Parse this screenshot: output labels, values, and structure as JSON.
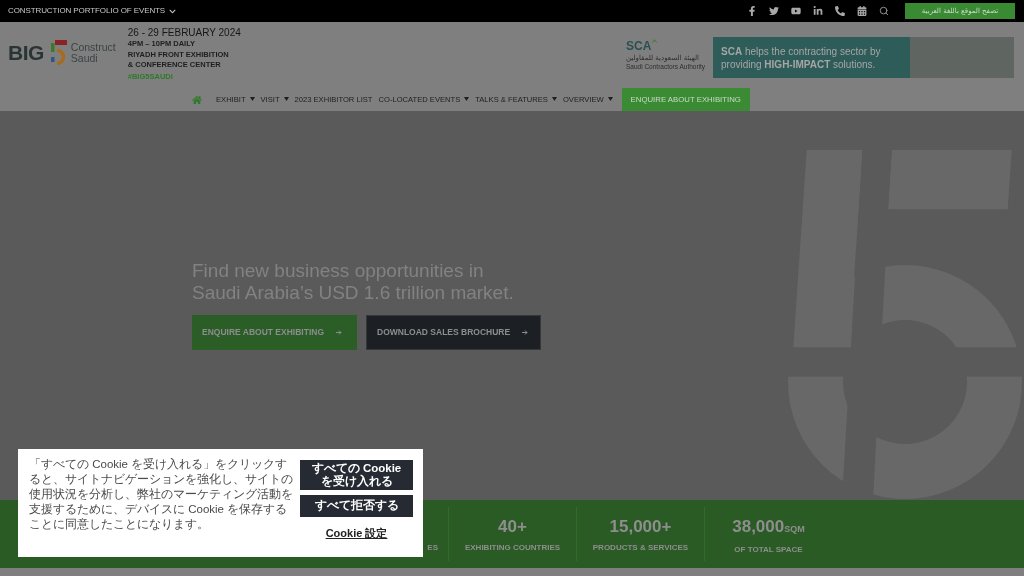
{
  "top_bar": {
    "title": "CONSTRUCTION PORTFOLIO OF EVENTS",
    "language_button": "تصفح الموقع باللغة العربية"
  },
  "header": {
    "logo": {
      "big": "BIG",
      "line_1": "Construct",
      "line_2": "Saudi"
    },
    "event": {
      "date": "26 - 29 FEBRUARY 2024",
      "lines": [
        "4PM – 10PM DAILY",
        "RIYADH FRONT EXHIBITION",
        "& CONFERENCE CENTER"
      ],
      "hashtag": "#BIG5SAUDI"
    },
    "partner": {
      "abbr": "SCA",
      "arabic": "الهيئة السعودية للمقاولين",
      "english": "Saudi Contractors Authority"
    },
    "ad": {
      "lines": [
        "**SCA** helps the contracting sector by",
        "providing **HIGH-IMPACT** solutions."
      ]
    }
  },
  "nav": {
    "items": [
      {
        "label": "EXHIBIT",
        "dropdown": true
      },
      {
        "label": "VISIT",
        "dropdown": true
      },
      {
        "label": "2023 EXHIBITOR LIST",
        "dropdown": false
      },
      {
        "label": "CO-LOCATED EVENTS",
        "dropdown": true
      },
      {
        "label": "TALKS & FEATURES",
        "dropdown": true
      },
      {
        "label": "OVERVIEW",
        "dropdown": true
      }
    ],
    "cta": "ENQUIRE ABOUT EXHIBITING"
  },
  "hero": {
    "headline": [
      "Find new business opportunities in",
      "Saudi Arabia’s USD 1.6 trillion market."
    ],
    "buttons": [
      {
        "label": "ENQUIRE ABOUT EXHIBITING",
        "kind": "primary"
      },
      {
        "label": "DOWNLOAD SALES BROCHURE",
        "kind": "secondary"
      }
    ]
  },
  "stats": [
    {
      "label": "ES"
    },
    {
      "value": "40+",
      "label": "EXHIBITING COUNTRIES"
    },
    {
      "value": "15,000+",
      "label": "PRODUCTS & SERVICES"
    },
    {
      "value": "38,000",
      "unit": "SQM",
      "label": "OF TOTAL SPACE"
    }
  ],
  "cookie_banner": {
    "text": "「すべての Cookie を受け入れる」をクリックすると、サイトナビゲーションを強化し、サイトの使用状況を分析し、弊社のマーケティング活動を支援するために、デバイスに Cookie を保存することに同意したことになります。",
    "accept_button": "すべての Cookie を受け入れる",
    "reject_button": "すべて拒否する",
    "settings_link": "Cookie 設定"
  }
}
